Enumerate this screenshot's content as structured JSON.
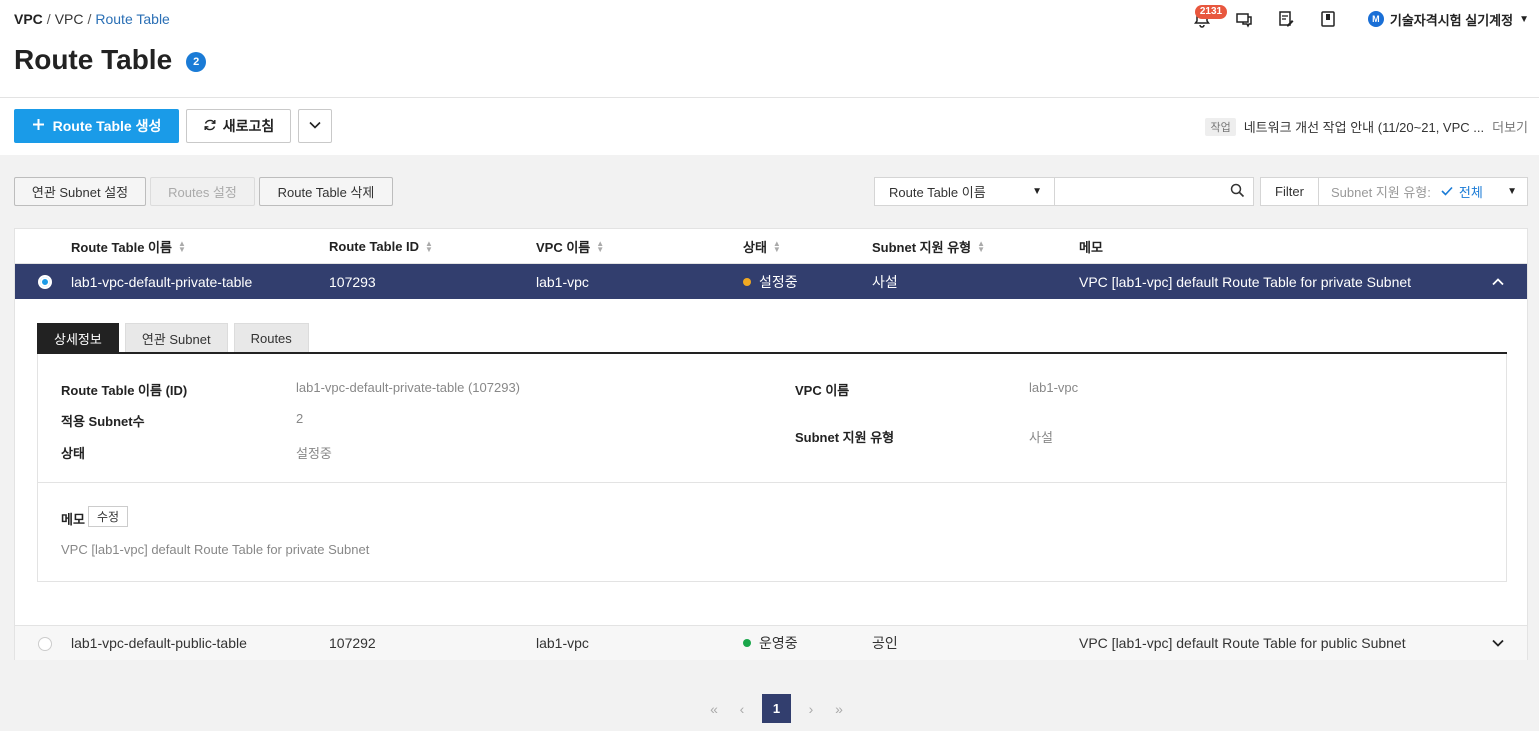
{
  "breadcrumb": {
    "root": "VPC",
    "level2": "VPC",
    "current": "Route Table",
    "sep": "/"
  },
  "page": {
    "title": "Route Table",
    "count_badge": "2"
  },
  "header": {
    "notification_count": "2131",
    "account_initial": "M",
    "account_name": "기술자격시험 실기계정"
  },
  "actions": {
    "create_label": "Route Table 생성",
    "refresh_label": "새로고침"
  },
  "notice": {
    "tag": "작업",
    "text": "네트워크 개선 작업 안내 (11/20~21, VPC ...",
    "more": "더보기"
  },
  "toolbar": {
    "assoc_subnet": "연관 Subnet 설정",
    "routes_setting": "Routes 설정",
    "delete": "Route Table 삭제"
  },
  "search": {
    "field": "Route Table 이름",
    "value": ""
  },
  "filter": {
    "label": "Filter",
    "key": "Subnet 지원 유형:",
    "value": "전체"
  },
  "table": {
    "columns": [
      "Route Table 이름",
      "Route Table ID",
      "VPC 이름",
      "상태",
      "Subnet 지원 유형",
      "메모"
    ],
    "rows": [
      {
        "name": "lab1-vpc-default-private-table",
        "id": "107293",
        "vpc": "lab1-vpc",
        "status": "설정중",
        "status_color": "#f0a922",
        "type": "사설",
        "memo": "VPC [lab1-vpc] default Route Table for private Subnet",
        "selected": true
      },
      {
        "name": "lab1-vpc-default-public-table",
        "id": "107292",
        "vpc": "lab1-vpc",
        "status": "운영중",
        "status_color": "#1aa64a",
        "type": "공인",
        "memo": "VPC [lab1-vpc] default Route Table for public Subnet",
        "selected": false
      }
    ]
  },
  "detail": {
    "tabs": [
      "상세정보",
      "연관 Subnet",
      "Routes"
    ],
    "active_tab": "상세정보",
    "labels": {
      "name_id": "Route Table 이름 (ID)",
      "subnet_count": "적용 Subnet수",
      "status": "상태",
      "vpc_name": "VPC 이름",
      "subnet_type": "Subnet 지원 유형",
      "memo": "메모"
    },
    "values": {
      "name_id": "lab1-vpc-default-private-table (107293)",
      "subnet_count": "2",
      "status": "설정중",
      "vpc_name": "lab1-vpc",
      "subnet_type": "사설",
      "memo": "VPC [lab1-vpc] default Route Table for private Subnet"
    },
    "memo_edit": "수정"
  },
  "pagination": {
    "current": "1"
  },
  "colors": {
    "accent": "#1a9be8",
    "selected_row": "#323e6e",
    "badge": "#1a7bd6"
  }
}
